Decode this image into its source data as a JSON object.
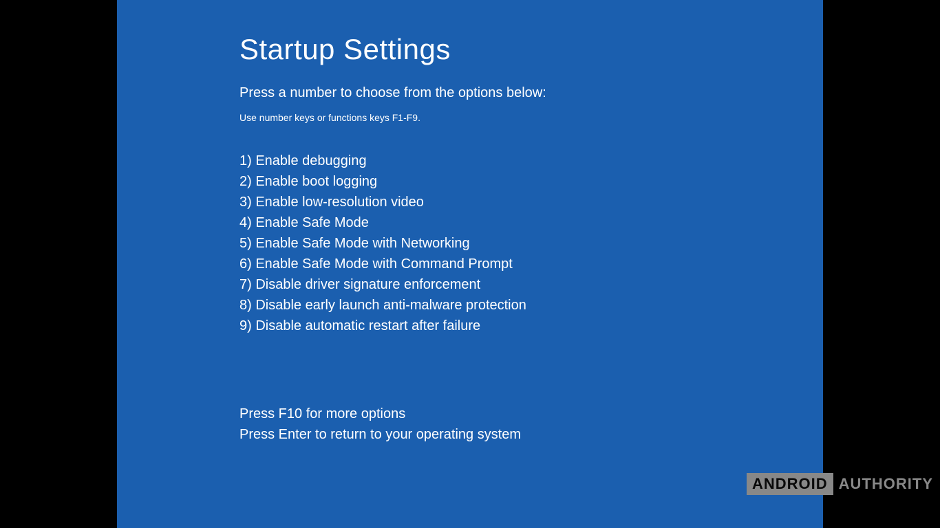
{
  "title": "Startup Settings",
  "subtitle": "Press a number to choose from the options below:",
  "hint": "Use number keys or functions keys F1-F9.",
  "options": [
    "1) Enable debugging",
    "2) Enable boot logging",
    "3) Enable low-resolution video",
    "4) Enable Safe Mode",
    "5) Enable Safe Mode with Networking",
    "6) Enable Safe Mode with Command Prompt",
    "7) Disable driver signature enforcement",
    "8) Disable early launch anti-malware protection",
    "9) Disable automatic restart after failure"
  ],
  "footer": {
    "more": "Press F10 for more options",
    "return": "Press Enter to return to your operating system"
  },
  "watermark": {
    "box": "ANDROID",
    "text": "AUTHORITY"
  }
}
